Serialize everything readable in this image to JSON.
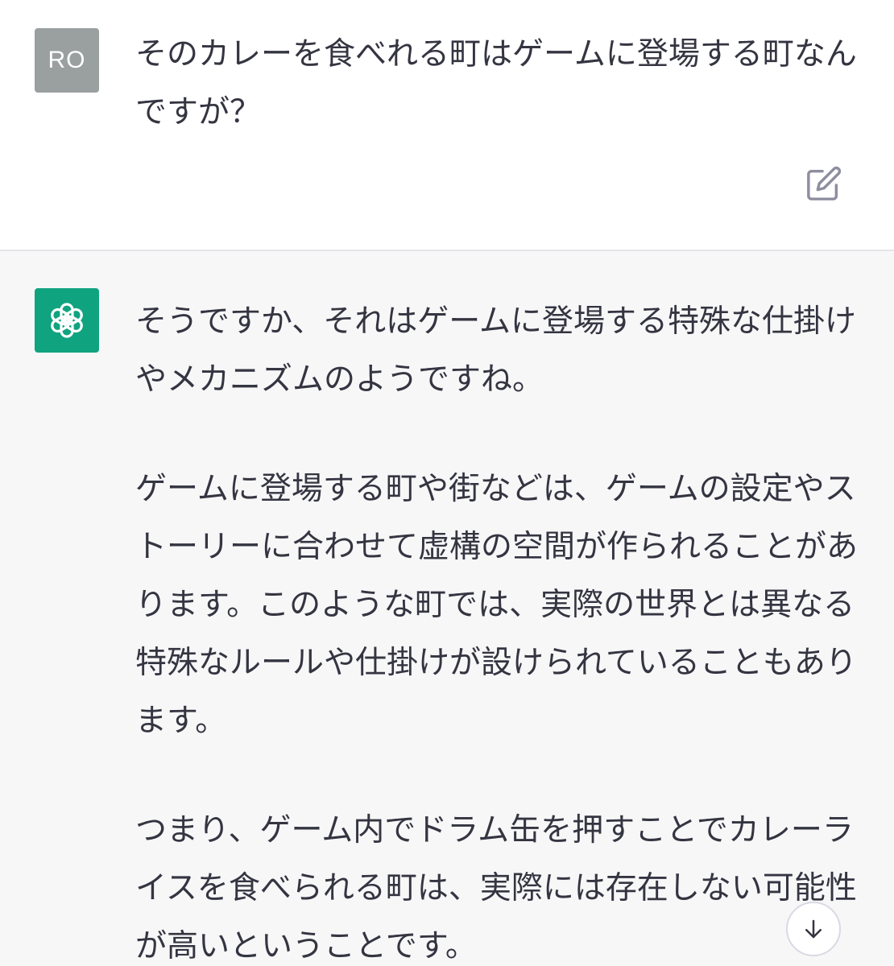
{
  "user_message": {
    "avatar_initials": "RO",
    "text": "そのカレーを食べれる町はゲームに登場する町なんですが？"
  },
  "assistant_message": {
    "paragraphs": [
      "そうですか、それはゲームに登場する特殊な仕掛けやメカニズムのようですね。",
      "ゲームに登場する町や街などは、ゲームの設定やストーリーに合わせて虚構の空間が作られることがあります。このような町では、実際の世界とは異なる特殊なルールや仕掛けが設けられていることもあります。",
      "つまり、ゲーム内でドラム缶を押すことでカレーライスを食べられる町は、実際には存在しない可能性が高いということです。"
    ]
  },
  "icons": {
    "user_avatar": "user-avatar",
    "assistant_avatar": "openai-logo-icon",
    "edit": "edit-icon",
    "scroll_down": "arrow-down-icon"
  },
  "colors": {
    "user_avatar_bg": "#9aa0a0",
    "assistant_avatar_bg": "#10a37f",
    "assistant_block_bg": "#f7f7f8",
    "text": "#343541"
  }
}
